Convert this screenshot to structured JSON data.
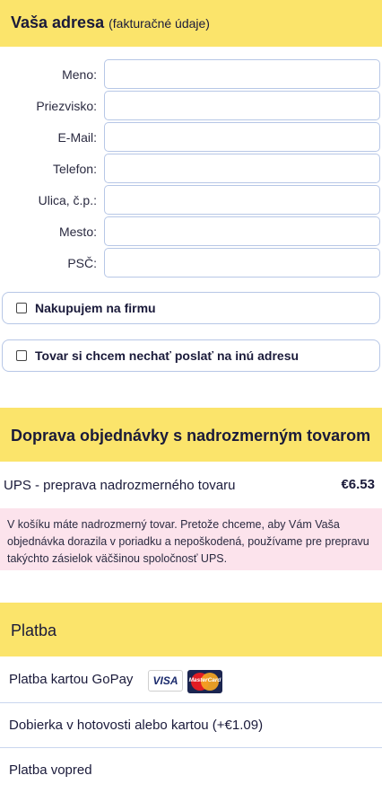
{
  "address": {
    "title": "Vaša adresa",
    "subtitle": "(fakturačné údaje)",
    "fields": [
      {
        "label": "Meno:",
        "value": ""
      },
      {
        "label": "Priezvisko:",
        "value": ""
      },
      {
        "label": "E-Mail:",
        "value": ""
      },
      {
        "label": "Telefon:",
        "value": ""
      },
      {
        "label": "Ulica, č.p.:",
        "value": ""
      },
      {
        "label": "Mesto:",
        "value": ""
      },
      {
        "label": "PSČ:",
        "value": ""
      }
    ],
    "company_checkbox": {
      "label": "Nakupujem na firmu",
      "checked": false
    },
    "other_address_checkbox": {
      "label": "Tovar si chcem nechať poslať na inú adresu",
      "checked": false
    }
  },
  "shipping": {
    "title": "Doprava objednávky s nadrozmerným tovarom",
    "option": {
      "name": "UPS - preprava nadrozmerného tovaru",
      "price": "€6.53"
    },
    "note": "V košíku máte nadrozmerný tovar. Pretože chceme, aby Vám Vaša objednávka dorazila v poriadku a nepoškodená, používame pre prepravu takýchto zásielok väčšinou spoločnosť UPS."
  },
  "payment": {
    "title": "Platba",
    "options": [
      {
        "label": "Platba kartou GoPay",
        "icons": [
          "visa-icon",
          "mastercard-icon"
        ]
      },
      {
        "label": "Dobierka v hotovosti alebo kartou (+€1.09)"
      },
      {
        "label": "Platba vopred"
      }
    ],
    "card_logos": {
      "visa": "VISA",
      "mastercard": "MasterCard"
    }
  },
  "colors": {
    "section_band": "#fbe46b",
    "input_border": "#b7c7e6",
    "note_background": "#fce3ec"
  }
}
